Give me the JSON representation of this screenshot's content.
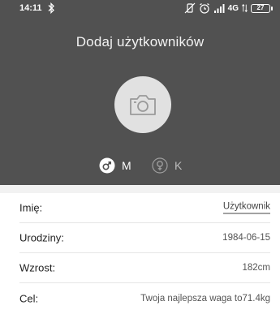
{
  "status_bar": {
    "time": "14:11",
    "network": "4G",
    "battery": "27"
  },
  "header": {
    "title": "Dodaj użytkowników"
  },
  "gender": {
    "male_label": "M",
    "female_label": "K",
    "selected": "M"
  },
  "form": {
    "rows": [
      {
        "label": "Imię:",
        "value": "Użytkownik"
      },
      {
        "label": "Urodziny:",
        "value": "1984-06-15"
      },
      {
        "label": "Wzrost:",
        "value": "182cm"
      },
      {
        "label": "Cel:",
        "value": "Twoja najlepsza waga to71.4kg"
      }
    ]
  },
  "colors": {
    "header_bg": "#515151",
    "avatar_bg": "#e1e1e1",
    "separator": "#f2f2f2"
  }
}
